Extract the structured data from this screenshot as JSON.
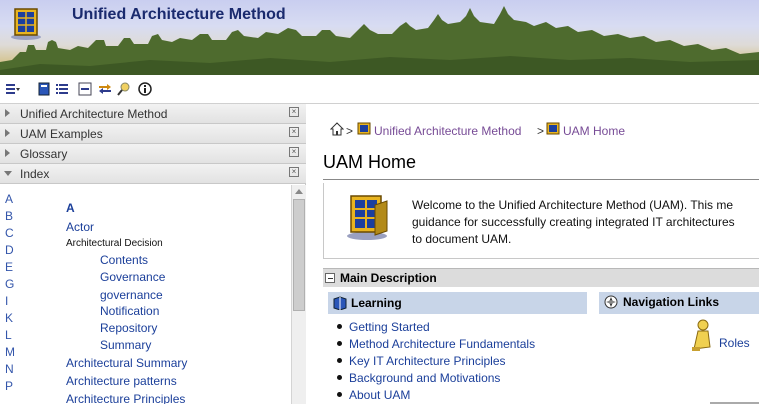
{
  "header": {
    "title": "Unified Architecture Method"
  },
  "toolbar": {
    "icons": [
      "list-dropdown-icon",
      "book-icon",
      "list-icon",
      "collapse-icon",
      "sync-icon",
      "search-icon",
      "info-icon"
    ]
  },
  "sidebar": {
    "sections": [
      {
        "label": "Unified Architecture Method",
        "expanded": false
      },
      {
        "label": "UAM Examples",
        "expanded": false
      },
      {
        "label": "Glossary",
        "expanded": false
      },
      {
        "label": "Index",
        "expanded": true
      }
    ],
    "letters": [
      "A",
      "B",
      "C",
      "D",
      "E",
      "G",
      "I",
      "K",
      "L",
      "M",
      "N",
      "P"
    ],
    "index_heading": "A",
    "index_items": [
      {
        "text": "Actor",
        "level": 1
      },
      {
        "text": "Architectural Decision",
        "level": 1
      },
      {
        "text": "Contents",
        "level": 2
      },
      {
        "text": "Governance",
        "level": 2
      },
      {
        "text": "governance",
        "level": 2
      },
      {
        "text": "Notification",
        "level": 2
      },
      {
        "text": "Repository",
        "level": 2
      },
      {
        "text": "Summary",
        "level": 2
      },
      {
        "text": "Architectural Summary",
        "level": 1
      },
      {
        "text": "Architecture patterns",
        "level": 1
      },
      {
        "text": "Architecture Principles",
        "level": 1
      }
    ]
  },
  "breadcrumb": {
    "separator": ">",
    "items": [
      "Unified Architecture Method",
      "UAM Home"
    ]
  },
  "main": {
    "title": "UAM Home",
    "intro_lines": [
      "Welcome to the Unified Architecture Method (UAM). This me",
      "guidance for successfully creating integrated IT architectures",
      "to document UAM."
    ],
    "section_label": "Main Description",
    "learning_label": "Learning",
    "learning_links": [
      "Getting Started",
      "Method Architecture Fundamentals",
      "Key IT Architecture Principles",
      "Background and Motivations",
      "About UAM"
    ],
    "navigation_label": "Navigation Links",
    "navigation_links": [
      "Roles"
    ]
  },
  "colors": {
    "link": "#1b3f9a",
    "breadcrumb": "#774b96",
    "title": "#1a2a6e",
    "section_bar": "#c8d5e8"
  }
}
